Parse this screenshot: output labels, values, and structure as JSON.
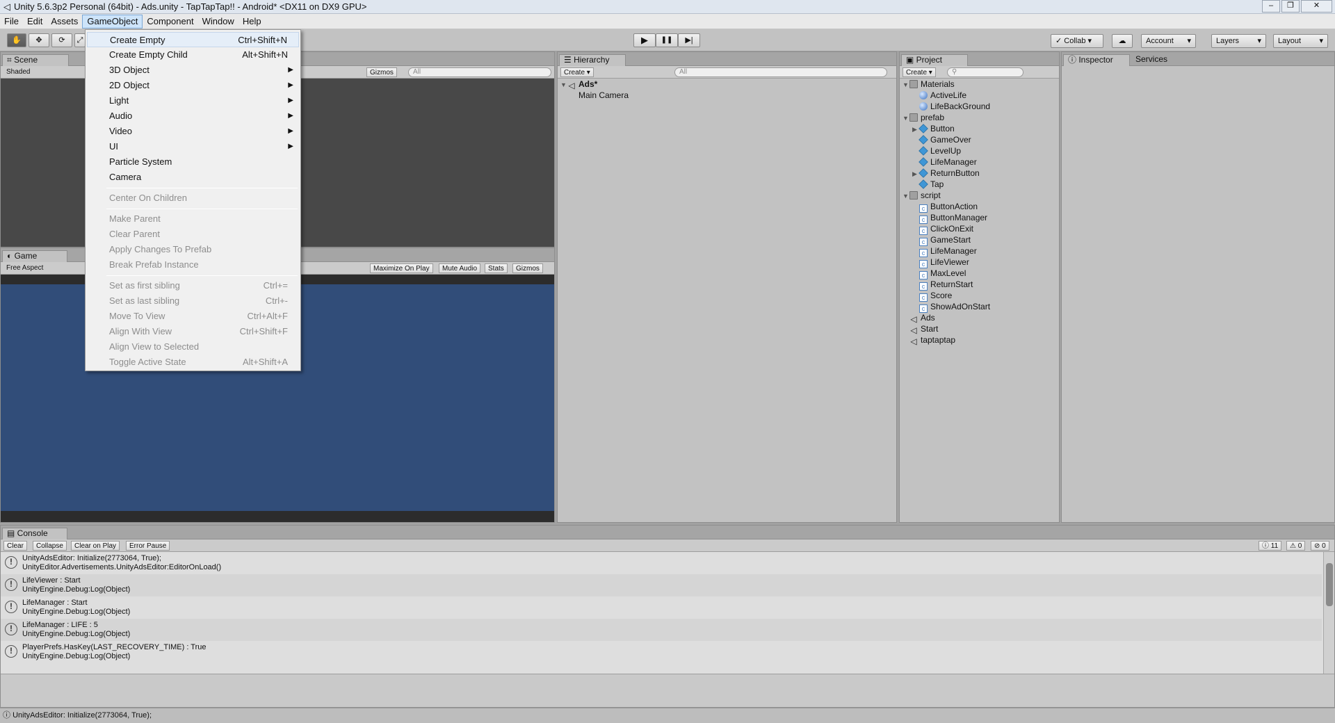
{
  "window": {
    "title": "Unity 5.6.3p2 Personal (64bit) - Ads.unity - TapTapTap!! - Android* <DX11 on DX9 GPU>",
    "controls": [
      "–",
      "❐",
      "✕"
    ]
  },
  "menubar": {
    "items": [
      "File",
      "Edit",
      "Assets",
      "GameObject",
      "Component",
      "Window",
      "Help"
    ],
    "active": "GameObject"
  },
  "toolbar": {
    "tools": [
      "hand-icon",
      "move-icon",
      "rotate-icon",
      "scale-icon"
    ],
    "play_icon": "▶",
    "pause_icon": "❚❚",
    "step_icon": "▶|",
    "collab_label": "Collab",
    "account_label": "Account",
    "layers_label": "Layers",
    "layout_label": "Layout",
    "dropdown_arrow": "▾",
    "cloud_icon": "☁",
    "check_icon": "✓"
  },
  "gameobject_menu": {
    "items": [
      {
        "label": "Create Empty",
        "shortcut": "Ctrl+Shift+N",
        "enabled": true
      },
      {
        "label": "Create Empty Child",
        "shortcut": "Alt+Shift+N",
        "enabled": true
      },
      {
        "label": "3D Object",
        "submenu": true,
        "enabled": true
      },
      {
        "label": "2D Object",
        "submenu": true,
        "enabled": true
      },
      {
        "label": "Light",
        "submenu": true,
        "enabled": true
      },
      {
        "label": "Audio",
        "submenu": true,
        "enabled": true
      },
      {
        "label": "Video",
        "submenu": true,
        "enabled": true
      },
      {
        "label": "UI",
        "submenu": true,
        "enabled": true
      },
      {
        "label": "Particle System",
        "enabled": true
      },
      {
        "label": "Camera",
        "enabled": true
      },
      {
        "label": "Center On Children",
        "enabled": false
      },
      {
        "label": "Make Parent",
        "enabled": false
      },
      {
        "label": "Clear Parent",
        "enabled": false
      },
      {
        "label": "Apply Changes To Prefab",
        "enabled": false
      },
      {
        "label": "Break Prefab Instance",
        "enabled": false
      },
      {
        "label": "Set as first sibling",
        "shortcut": "Ctrl+=",
        "enabled": false
      },
      {
        "label": "Set as last sibling",
        "shortcut": "Ctrl+-",
        "enabled": false
      },
      {
        "label": "Move To View",
        "shortcut": "Ctrl+Alt+F",
        "enabled": false
      },
      {
        "label": "Align With View",
        "shortcut": "Ctrl+Shift+F",
        "enabled": false
      },
      {
        "label": "Align View to Selected",
        "enabled": false
      },
      {
        "label": "Toggle Active State",
        "shortcut": "Alt+Shift+A",
        "enabled": false
      }
    ],
    "submenu_arrow": "▶"
  },
  "scene": {
    "tab": "Scene",
    "shading": "Shaded",
    "gizmos": "Gizmos",
    "search_placeholder": "All"
  },
  "game": {
    "tab": "Game",
    "aspect": "Free Aspect",
    "buttons": [
      "Maximize On Play",
      "Mute Audio",
      "Stats",
      "Gizmos"
    ],
    "background_color": "#314d79"
  },
  "hierarchy": {
    "tab": "Hierarchy",
    "create": "Create",
    "search_placeholder": "All",
    "scene_name": "Ads*",
    "items": [
      "Main Camera"
    ]
  },
  "project": {
    "tab": "Project",
    "create": "Create",
    "tree": [
      {
        "label": "Materials",
        "type": "folder",
        "depth": 0,
        "expanded": true
      },
      {
        "label": "ActiveLife",
        "type": "material",
        "depth": 1
      },
      {
        "label": "LifeBackGround",
        "type": "material",
        "depth": 1
      },
      {
        "label": "prefab",
        "type": "folder",
        "depth": 0,
        "expanded": true
      },
      {
        "label": "Button",
        "type": "prefab",
        "depth": 1,
        "collapsed": true
      },
      {
        "label": "GameOver",
        "type": "prefab",
        "depth": 1
      },
      {
        "label": "LevelUp",
        "type": "prefab",
        "depth": 1
      },
      {
        "label": "LifeManager",
        "type": "prefab",
        "depth": 1
      },
      {
        "label": "ReturnButton",
        "type": "prefab",
        "depth": 1,
        "collapsed": true
      },
      {
        "label": "Tap",
        "type": "prefab",
        "depth": 1
      },
      {
        "label": "script",
        "type": "folder",
        "depth": 0,
        "expanded": true
      },
      {
        "label": "ButtonAction",
        "type": "script",
        "depth": 1
      },
      {
        "label": "ButtonManager",
        "type": "script",
        "depth": 1
      },
      {
        "label": "ClickOnExit",
        "type": "script",
        "depth": 1
      },
      {
        "label": "GameStart",
        "type": "script",
        "depth": 1
      },
      {
        "label": "LifeManager",
        "type": "script",
        "depth": 1
      },
      {
        "label": "LifeViewer",
        "type": "script",
        "depth": 1
      },
      {
        "label": "MaxLevel",
        "type": "script",
        "depth": 1
      },
      {
        "label": "ReturnStart",
        "type": "script",
        "depth": 1
      },
      {
        "label": "Score",
        "type": "script",
        "depth": 1
      },
      {
        "label": "ShowAdOnStart",
        "type": "script",
        "depth": 1
      },
      {
        "label": "Ads",
        "type": "scene",
        "depth": 0
      },
      {
        "label": "Start",
        "type": "scene",
        "depth": 0
      },
      {
        "label": "taptaptap",
        "type": "scene",
        "depth": 0
      }
    ]
  },
  "inspector": {
    "tab": "Inspector",
    "services_tab": "Services"
  },
  "console": {
    "tab": "Console",
    "buttons": [
      "Clear",
      "Collapse",
      "Clear on Play",
      "Error Pause"
    ],
    "counts": {
      "log": "11",
      "warn": "0",
      "error": "0"
    },
    "entries": [
      {
        "line1": "UnityAdsEditor: Initialize(2773064, True);",
        "line2": "UnityEditor.Advertisements.UnityAdsEditor:EditorOnLoad()"
      },
      {
        "line1": "LifeViewer : Start",
        "line2": "UnityEngine.Debug:Log(Object)"
      },
      {
        "line1": "LifeManager : Start",
        "line2": "UnityEngine.Debug:Log(Object)"
      },
      {
        "line1": "LifeManager : LIFE : 5",
        "line2": "UnityEngine.Debug:Log(Object)"
      },
      {
        "line1": "PlayerPrefs.HasKey(LAST_RECOVERY_TIME) : True",
        "line2": "UnityEngine.Debug:Log(Object)"
      }
    ]
  },
  "statusbar": {
    "text": "UnityAdsEditor: Initialize(2773064, True);"
  }
}
